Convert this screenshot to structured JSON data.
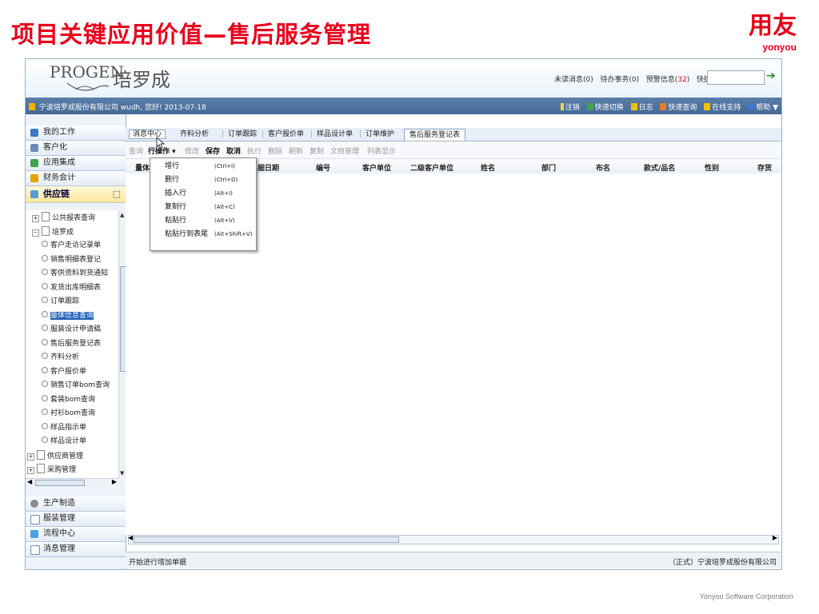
{
  "slide": {
    "title": "项目关键应用价值—售后服务管理",
    "logo_main": "用友",
    "logo_sub": "yonyou",
    "footer": "Yonyou Software Corporation"
  },
  "app": {
    "brand_en": "PROGEN",
    "brand_cn": "培罗成",
    "header_links": {
      "unread": "未读消息(0)",
      "todo": "待办事务(0)",
      "alert_prefix": "预警信息(",
      "alert_count": "32",
      "alert_suffix": ")",
      "shortcode": "快捷码"
    },
    "infobar": {
      "company": "宁波培罗成股份有限公司",
      "greeting": "wudh, 您好! 2013-07-18",
      "actions": [
        "注销",
        "快速切换",
        "日志",
        "快速查询",
        "在线支持",
        "帮助"
      ]
    },
    "nav": {
      "items_top": [
        "我的工作",
        "客户化",
        "应用集成",
        "财务会计",
        "供应链"
      ],
      "items_bottom": [
        "生产制造",
        "服装管理",
        "流程中心",
        "消息管理"
      ],
      "tree": [
        {
          "label": "公共报表查询",
          "level": 1,
          "kind": "folder",
          "toggle": "+"
        },
        {
          "label": "培罗成",
          "level": 1,
          "kind": "folder",
          "toggle": "−"
        },
        {
          "label": "客户走访记录单",
          "level": 2,
          "kind": "leaf"
        },
        {
          "label": "销售明细表登记",
          "level": 2,
          "kind": "leaf"
        },
        {
          "label": "客供资料到货通知",
          "level": 2,
          "kind": "leaf"
        },
        {
          "label": "发货出库明细表",
          "level": 2,
          "kind": "leaf"
        },
        {
          "label": "订单跟踪",
          "level": 2,
          "kind": "leaf"
        },
        {
          "label": "量体信息查询",
          "level": 2,
          "kind": "leaf",
          "selected": true
        },
        {
          "label": "服装设计申请稿",
          "level": 2,
          "kind": "leaf"
        },
        {
          "label": "售后服务登记表",
          "level": 2,
          "kind": "leaf"
        },
        {
          "label": "齐料分析",
          "level": 2,
          "kind": "leaf"
        },
        {
          "label": "客户报价单",
          "level": 2,
          "kind": "leaf"
        },
        {
          "label": "销售订单bom查询",
          "level": 2,
          "kind": "leaf"
        },
        {
          "label": "套装bom查询",
          "level": 2,
          "kind": "leaf"
        },
        {
          "label": "衬衫bom查询",
          "level": 2,
          "kind": "leaf"
        },
        {
          "label": "样品指示单",
          "level": 2,
          "kind": "leaf"
        },
        {
          "label": "样品设计单",
          "level": 2,
          "kind": "leaf"
        },
        {
          "label": "供应商管理",
          "level": 0,
          "kind": "folder",
          "toggle": "+"
        },
        {
          "label": "采购管理",
          "level": 0,
          "kind": "folder",
          "toggle": "+"
        }
      ]
    },
    "tabs": [
      "消息中心",
      "齐料分析",
      "订单跟踪",
      "客户报价单",
      "样品设计单",
      "订单维护",
      "售后服务登记表"
    ],
    "toolbar": [
      "查询",
      "行操作 ▾",
      "修改",
      "保存",
      "取消",
      "执行",
      "删除",
      "刷新",
      "复制",
      "文档管理",
      "列表显示"
    ],
    "grid_columns": [
      "量体",
      "单据日期",
      "编号",
      "客户单位",
      "二级客户单位",
      "姓名",
      "部门",
      "布名",
      "款式/品名",
      "性别",
      "存货"
    ],
    "dropdown": [
      {
        "label": "增行",
        "shortcut": "(Ctrl+I)"
      },
      {
        "label": "删行",
        "shortcut": "(Ctrl+D)"
      },
      {
        "label": "插入行",
        "shortcut": "(Alt+I)"
      },
      {
        "label": "复制行",
        "shortcut": "(Alt+C)"
      },
      {
        "label": "粘贴行",
        "shortcut": "(Alt+V)"
      },
      {
        "label": "粘贴行到表尾",
        "shortcut": "(Alt+Shift+V)"
      }
    ],
    "status_left": "开始进行增加单据",
    "status_right": "（正式）宁波培罗成股份有限公司"
  },
  "colors": {
    "accent_red": "#e8001c",
    "bar_blue": "#4d71a0",
    "selection": "#1f5fb7"
  }
}
